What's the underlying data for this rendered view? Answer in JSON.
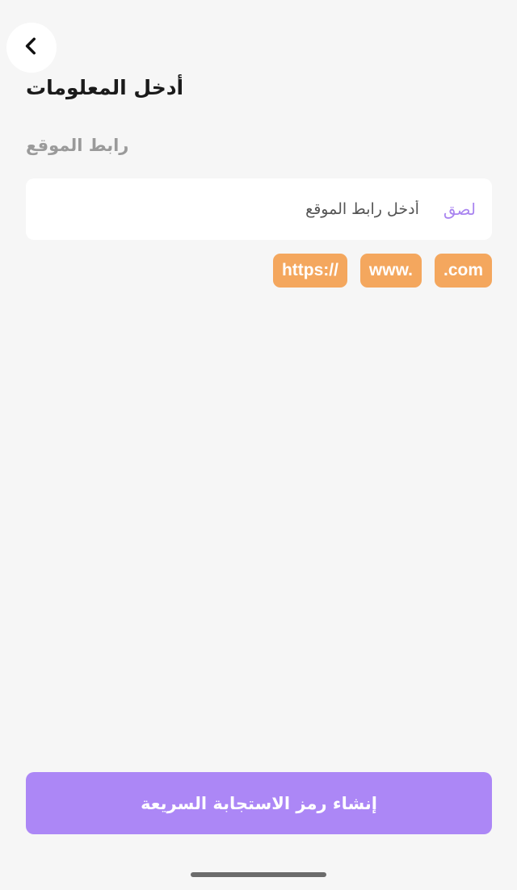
{
  "header": {
    "back_icon": "chevron-left-icon",
    "title": "أدخل المعلومات"
  },
  "form": {
    "field_label": "رابط الموقع",
    "placeholder": "أدخل رابط الموقع",
    "paste_label": "لصق"
  },
  "chips": [
    ".com",
    "www.",
    "https://"
  ],
  "footer": {
    "submit_label": "إنشاء رمز الاستجابة السريعة"
  },
  "colors": {
    "accent": "#ac87f6",
    "chip": "#f4a75e",
    "background": "#f6f6f6"
  }
}
